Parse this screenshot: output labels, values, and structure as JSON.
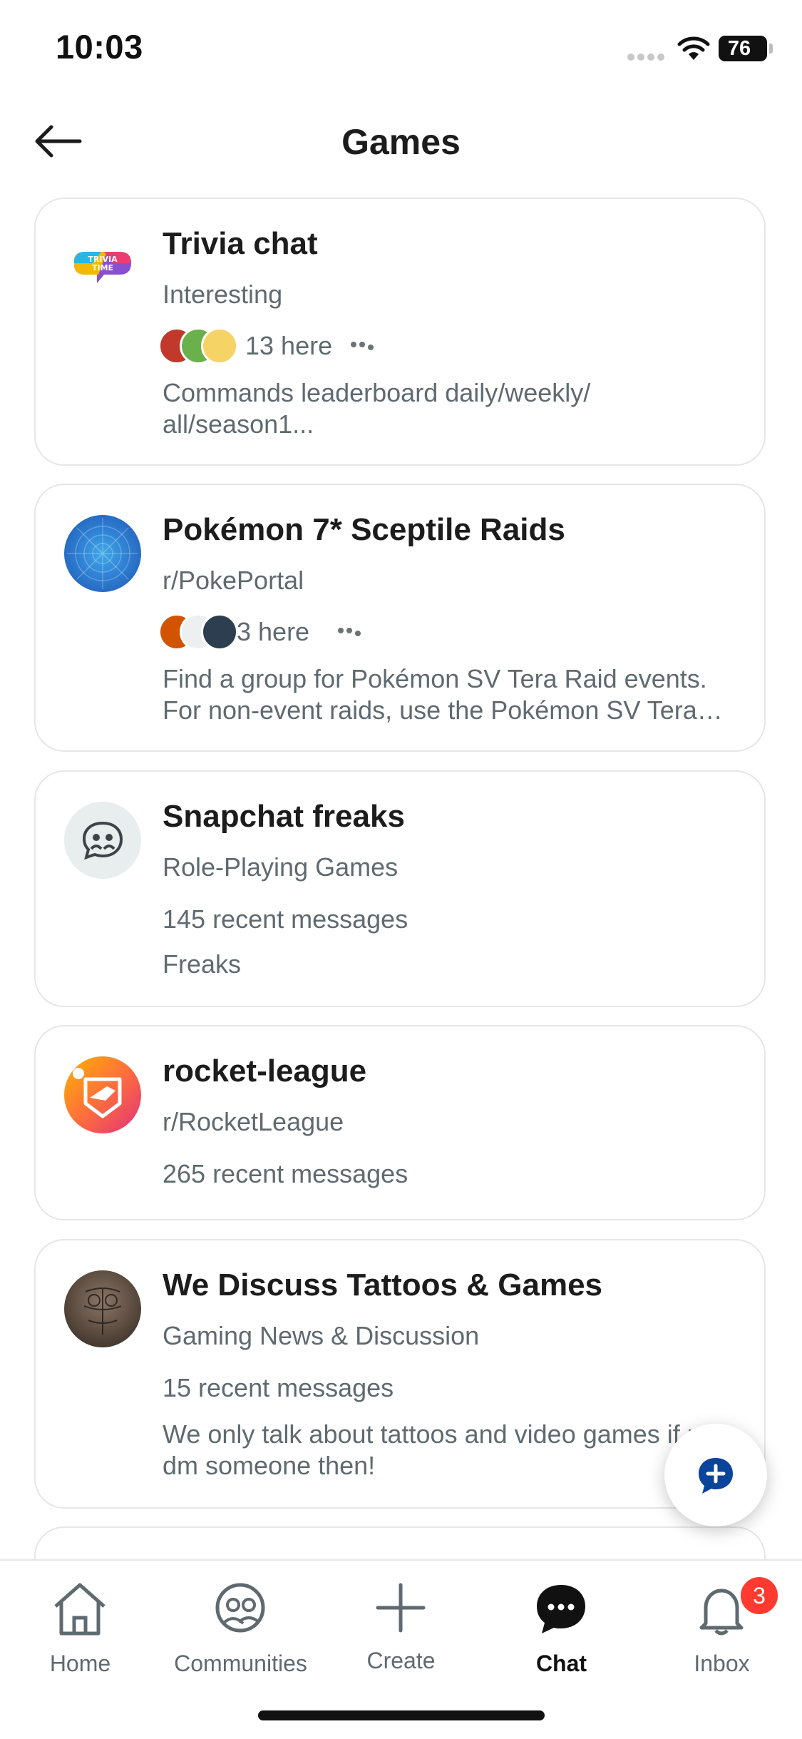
{
  "status_bar": {
    "time": "10:03",
    "battery": "76"
  },
  "header": {
    "title": "Games"
  },
  "cards": [
    {
      "title": "Trivia chat",
      "subtitle": "Interesting",
      "here": "13 here",
      "description": "Commands leaderboard daily/weekly/ all/season1...",
      "icon_text": "TRIVIA TIME"
    },
    {
      "title": "Pokémon 7* Sceptile Raids",
      "subtitle": "r/PokePortal",
      "here": "3 here",
      "description": "Find a group for Pokémon SV Tera Raid events. For non-event raids, use the Pokémon SV Tera Raid channel..."
    },
    {
      "title": "Snapchat freaks",
      "subtitle": "Role-Playing Games",
      "recent": "145 recent messages",
      "description": "Freaks"
    },
    {
      "title": "rocket-league",
      "subtitle": "r/RocketLeague",
      "recent": "265 recent messages"
    },
    {
      "title": "We Discuss Tattoos & Games",
      "subtitle": "Gaming News & Discussion",
      "recent": "15 recent messages",
      "description": "We only talk about tattoos and video games if not; dm someone then!"
    }
  ],
  "tabs": [
    {
      "label": "Home"
    },
    {
      "label": "Communities"
    },
    {
      "label": "Create"
    },
    {
      "label": "Chat",
      "active": true
    },
    {
      "label": "Inbox",
      "badge": "3"
    }
  ],
  "colors": {
    "accent": "#0a449b",
    "badge": "#ff3b30",
    "text_secondary": "#5f6a70"
  }
}
